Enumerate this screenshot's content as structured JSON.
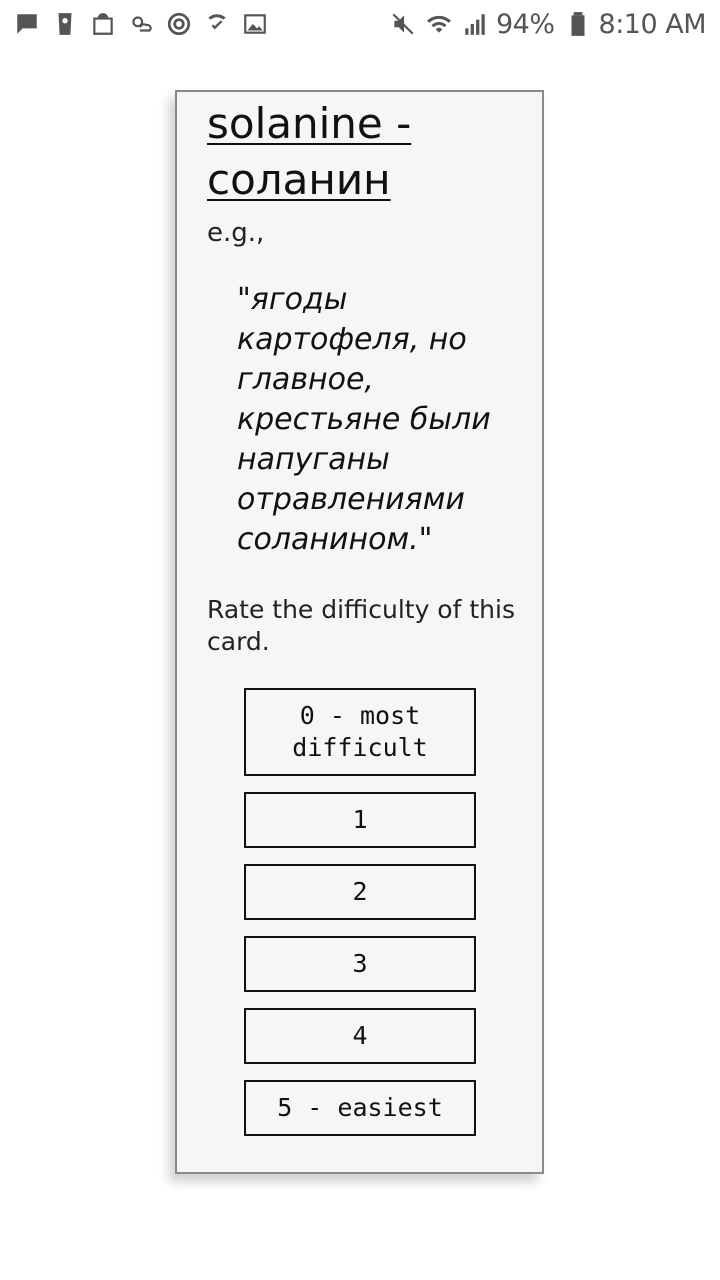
{
  "status_bar": {
    "left_icons": [
      "message-icon",
      "app-icon",
      "shopping-bag-icon",
      "weather-icon",
      "sync-icon",
      "wifi-call-icon",
      "image-icon"
    ],
    "right_icons": [
      "mute-icon",
      "wifi-icon",
      "signal-icon",
      "battery-icon"
    ],
    "battery_percent": "94%",
    "time": "8:10 AM"
  },
  "card": {
    "title": "solanine - соланин",
    "example_label": "e.g.,",
    "example_quote": "\"ягоды картофеля, но главное, крестьяне были напуганы отравлениями соланином.\"",
    "rate_prompt": "Rate the difficulty of this card.",
    "buttons": [
      {
        "label": "0 - most difficult"
      },
      {
        "label": "1"
      },
      {
        "label": "2"
      },
      {
        "label": "3"
      },
      {
        "label": "4"
      },
      {
        "label": "5 - easiest"
      }
    ]
  }
}
